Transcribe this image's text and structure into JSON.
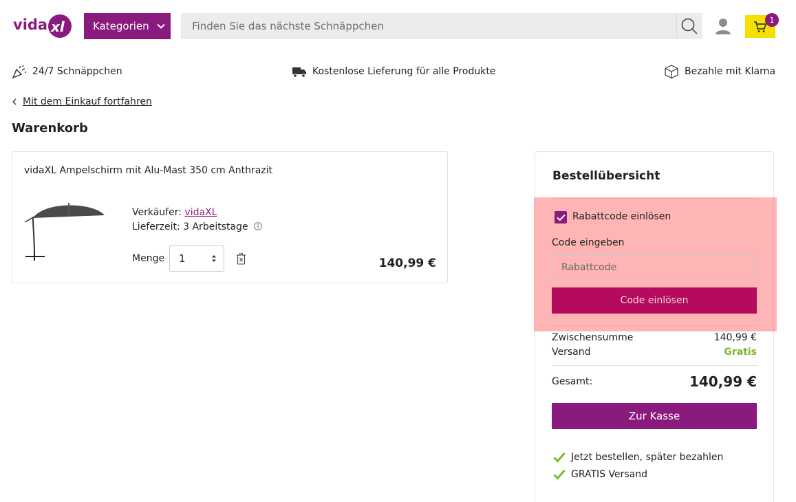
{
  "header": {
    "logo_text": "vidaXL",
    "categories_label": "Kategorien",
    "search_placeholder": "Finden Sie das nächste Schnäppchen",
    "cart_count": "1",
    "brand_color": "#8a1a7d",
    "cart_color": "#f5e000"
  },
  "usp": [
    {
      "icon": "party-popper-icon",
      "label": "24/7 Schnäppchen"
    },
    {
      "icon": "delivery-truck-icon",
      "label": "Kostenlose Lieferung für alle Produkte"
    },
    {
      "icon": "box-icon",
      "label": "Bezahle mit Klarna"
    }
  ],
  "back_link": "Mit dem Einkauf fortfahren",
  "page_title": "Warenkorb",
  "product": {
    "title": "vidaXL Ampelschirm mit Alu-Mast 350 cm Anthrazit",
    "seller_label": "Verkäufer:",
    "seller_name": "vidaXL",
    "delivery_label": "Lieferzeit:",
    "delivery_value": "3 Arbeitstage",
    "quantity_label": "Menge",
    "quantity_value": "1",
    "price": "140,99 €"
  },
  "summary": {
    "title": "Bestellübersicht",
    "coupon_checkbox_label": "Rabattcode einlösen",
    "coupon_checked": true,
    "code_label": "Code eingeben",
    "code_placeholder": "Rabattcode",
    "redeem_button": "Code einlösen",
    "subtotal_label": "Zwischensumme",
    "subtotal_value": "140,99 €",
    "shipping_label": "Versand",
    "shipping_value": "Gratis",
    "total_label": "Gesamt:",
    "total_value": "140,99 €",
    "checkout_button": "Zur Kasse",
    "benefits": [
      "Jetzt bestellen, später bezahlen",
      "GRATIS Versand"
    ]
  }
}
